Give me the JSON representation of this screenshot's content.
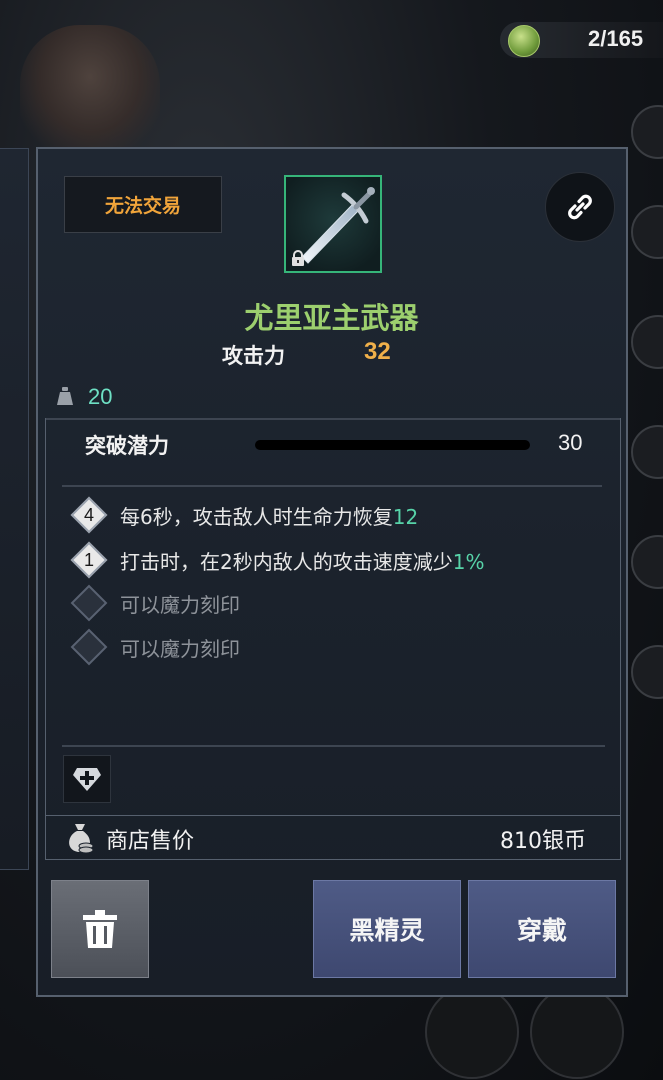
{
  "header": {
    "counter_icon": "fist-token-icon",
    "counter_text": "2/165"
  },
  "item": {
    "trade_status": "无法交易",
    "icon": "sword-icon",
    "locked": true,
    "name": "尤里亚主武器",
    "attack_label": "攻击力",
    "attack_value": "32",
    "weight": "20",
    "breakthrough_label": "突破潜力",
    "breakthrough_value": "30"
  },
  "options": [
    {
      "level": "4",
      "text": "每6秒，攻击敌人时生命力恢复",
      "highlight": "12",
      "enabled": true
    },
    {
      "level": "1",
      "text": "打击时，在2秒内敌人的攻击速度减少",
      "highlight": "1%",
      "enabled": true
    },
    {
      "level": "",
      "text": "可以魔力刻印",
      "highlight": "",
      "enabled": false
    },
    {
      "level": "",
      "text": "可以魔力刻印",
      "highlight": "",
      "enabled": false
    }
  ],
  "shop": {
    "label": "商店售价",
    "value": "810银币"
  },
  "buttons": {
    "race_label": "黑精灵",
    "equip_label": "穿戴"
  },
  "colors": {
    "item_name": "#9ccf6e",
    "attack_value": "#f0b04a",
    "trade_status": "#f0a43a",
    "highlight": "#57d3a8",
    "icon_frame": "#36b579"
  }
}
